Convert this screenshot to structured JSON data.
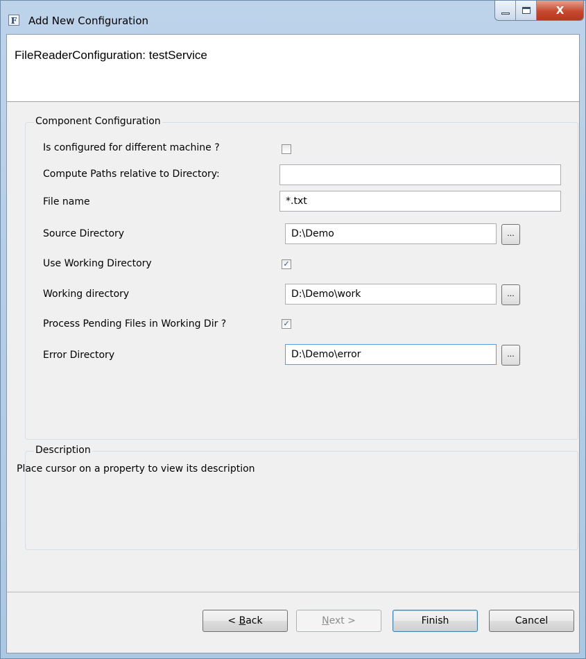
{
  "window": {
    "title": "Add New Configuration",
    "app_icon_letter": "F",
    "close_glyph": "X"
  },
  "banner": {
    "title": "FileReaderConfiguration: testService"
  },
  "component_configuration": {
    "legend": "Component Configuration",
    "rows": [
      {
        "label": "Is configured for different machine ?",
        "type": "checkbox",
        "checked": false
      },
      {
        "label": "Compute Paths relative to Directory:",
        "type": "text",
        "value": ""
      },
      {
        "label": "File name",
        "type": "text",
        "value": "*.txt"
      },
      {
        "label": "Source Directory",
        "type": "path",
        "value": "D:\\Demo",
        "browse_label": "..."
      },
      {
        "label": "Use Working Directory",
        "type": "checkbox",
        "checked": true
      },
      {
        "label": "Working directory",
        "type": "path",
        "value": "D:\\Demo\\work",
        "browse_label": "..."
      },
      {
        "label": "Process Pending Files in Working Dir ?",
        "type": "checkbox",
        "checked": true
      },
      {
        "label": "Error Directory",
        "type": "path",
        "value": "D:\\Demo\\error",
        "browse_label": "..."
      }
    ]
  },
  "description": {
    "legend": "Description",
    "text": "Place cursor on a property to view its description"
  },
  "buttons": {
    "back_pre": "< ",
    "back_mnemonic": "B",
    "back_post": "ack",
    "next_mnemonic": "N",
    "next_post": "ext >",
    "finish": "Finish",
    "cancel": "Cancel"
  },
  "colors": {
    "title_bar": "#aac7e3",
    "dialog_bg": "#f0f0f0",
    "close_button": "#c64a2f",
    "check_mark": "#2c5a9c",
    "focus_border": "#569de5"
  }
}
